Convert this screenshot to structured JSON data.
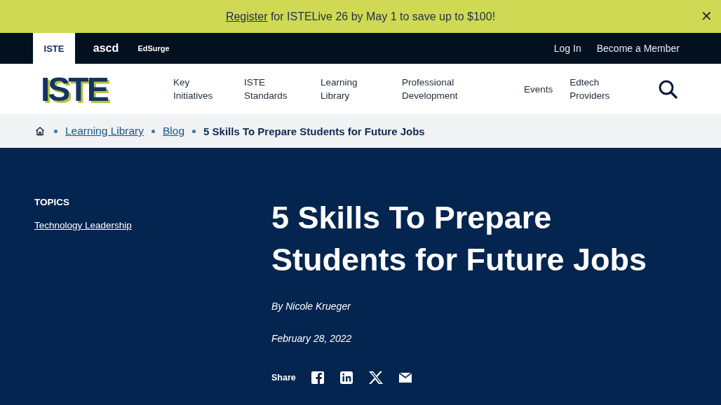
{
  "banner": {
    "link": "Register",
    "text": " for ISTELive 26 by May 1 to save up to $100!",
    "close": "✕"
  },
  "brand_tabs": [
    {
      "label": "ISTE",
      "selected": true
    },
    {
      "label": "ascd",
      "selected": false
    },
    {
      "label": "EdSurge",
      "selected": false
    }
  ],
  "account_links": [
    "Log In",
    "Become a Member"
  ],
  "logo": "ISTE",
  "nav": [
    {
      "label": "Key Initiatives"
    },
    {
      "label": "ISTE Standards"
    },
    {
      "label": "Learning Library"
    },
    {
      "label": "Professional Development"
    },
    {
      "label": "Events"
    },
    {
      "label": "Edtech Providers"
    }
  ],
  "breadcrumb": {
    "links": [
      "Learning Library",
      "Blog"
    ],
    "current": "5 Skills To Prepare Students for Future Jobs"
  },
  "topics": {
    "heading": "TOPICS",
    "items": [
      "Technology Leadership"
    ]
  },
  "article": {
    "title": "5 Skills To Prepare Students for Future Jobs",
    "author": "By Nicole Krueger",
    "date": "February 28, 2022",
    "share_label": "Share"
  }
}
